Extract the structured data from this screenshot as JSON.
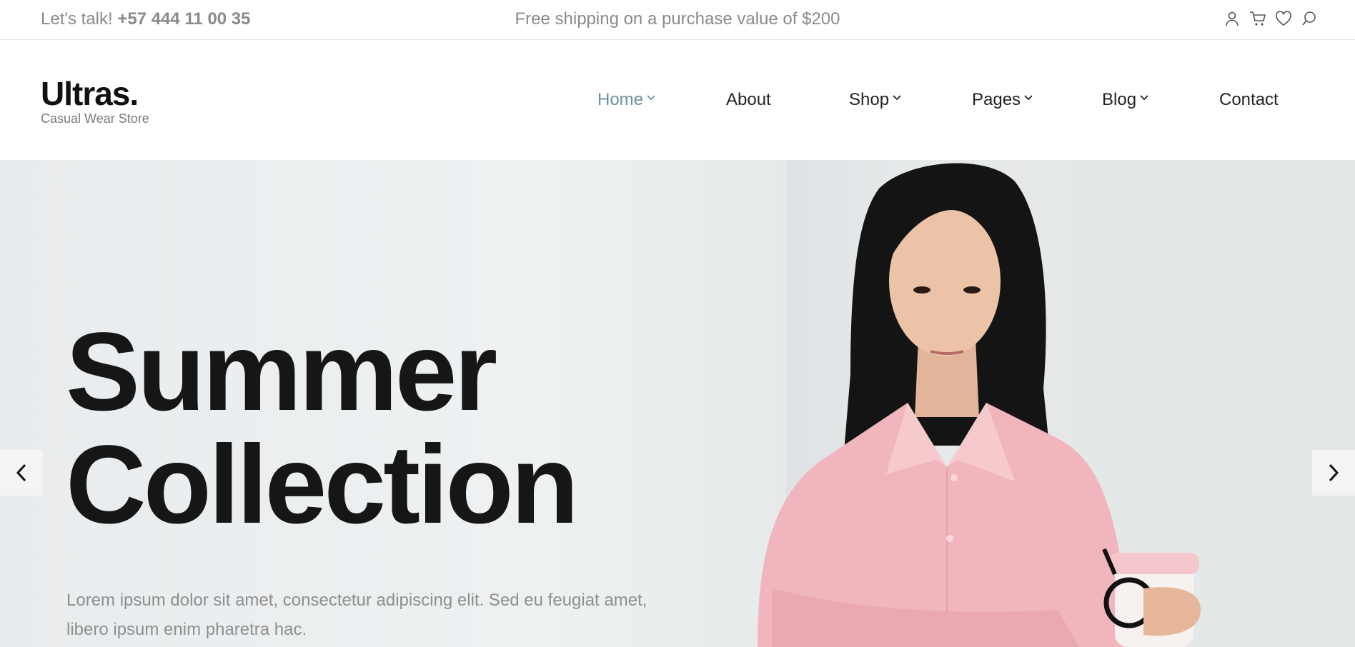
{
  "topbar": {
    "talk_label": "Let's talk!",
    "phone": "+57 444 11 00 35",
    "shipping": "Free shipping on a purchase value of $200",
    "icons": [
      "user-icon",
      "cart-icon",
      "heart-icon",
      "search-icon"
    ]
  },
  "logo": {
    "name": "Ultras.",
    "tagline": "Casual Wear Store"
  },
  "nav": {
    "items": [
      {
        "label": "Home",
        "active": true,
        "dropdown": true
      },
      {
        "label": "About",
        "active": false,
        "dropdown": false
      },
      {
        "label": "Shop",
        "active": false,
        "dropdown": true
      },
      {
        "label": "Pages",
        "active": false,
        "dropdown": true
      },
      {
        "label": "Blog",
        "active": false,
        "dropdown": true
      },
      {
        "label": "Contact",
        "active": false,
        "dropdown": false
      }
    ]
  },
  "hero": {
    "title_line1": "Summer",
    "title_line2": "Collection",
    "description": "Lorem ipsum dolor sit amet, consectetur adipiscing elit. Sed eu feugiat amet, libero ipsum enim pharetra hac."
  },
  "colors": {
    "accent": "#6b8fa6",
    "text_dark": "#161616",
    "text_muted": "#8a8a8a",
    "shirt": "#f1b6bd"
  }
}
